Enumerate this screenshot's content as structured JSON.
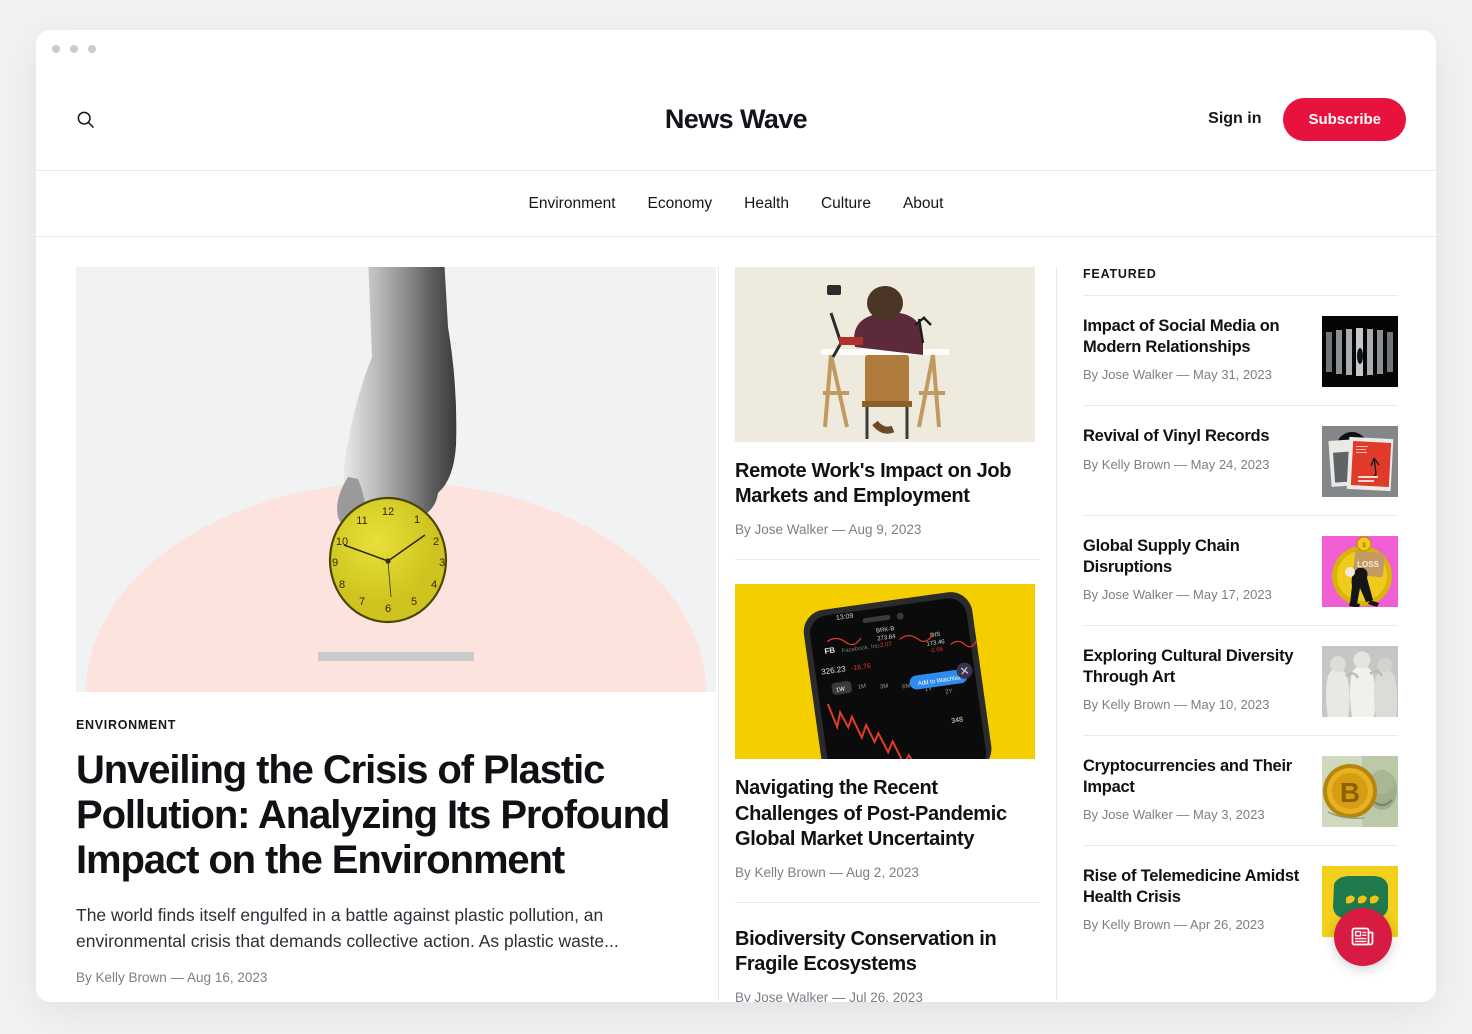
{
  "window": {
    "dots": 3
  },
  "masthead": {
    "brand": "News Wave",
    "search_icon": "search-icon",
    "signin_label": "Sign in",
    "subscribe_label": "Subscribe",
    "accent_color": "#e8123e"
  },
  "nav": {
    "items": [
      {
        "label": "Environment"
      },
      {
        "label": "Economy"
      },
      {
        "label": "Health"
      },
      {
        "label": "Culture"
      },
      {
        "label": "About"
      }
    ]
  },
  "hero": {
    "image_alt": "hand-holding-yellow-clock-illustration",
    "kicker": "ENVIRONMENT",
    "title": "Unveiling the Crisis of Plastic Pollution: Analyzing Its Profound Impact on the Environment",
    "excerpt": "The world finds itself engulfed in a battle against plastic pollution, an environmental crisis that demands collective action. As plastic waste...",
    "byline": "By Kelly Brown — Aug 16, 2023"
  },
  "mid_column": {
    "cards": [
      {
        "image_alt": "person-at-desk-working-photo",
        "title": "Remote Work's Impact on Job Markets and Employment",
        "byline": "By Jose Walker — Aug 9, 2023",
        "has_image": true
      },
      {
        "image_alt": "smartphone-stock-chart-on-yellow-photo",
        "title": "Navigating the Recent Challenges of Post-Pandemic Global Market Uncertainty",
        "byline": "By Kelly Brown — Aug 2, 2023",
        "has_image": true
      },
      {
        "image_alt": "",
        "title": "Biodiversity Conservation in Fragile Ecosystems",
        "byline": "By Jose Walker — Jul 26, 2023",
        "has_image": false
      }
    ]
  },
  "sidebar": {
    "section_label": "FEATURED",
    "items": [
      {
        "title": "Impact of Social Media on Modern Relationships",
        "byline": "By Jose Walker — May 31, 2023",
        "thumb_alt": "dark-vertical-blinds-silhouette-photo"
      },
      {
        "title": "Revival of Vinyl Records",
        "byline": "By Kelly Brown — May 24, 2023",
        "thumb_alt": "vinyl-record-sleeve-red-photo"
      },
      {
        "title": "Global Supply Chain Disruptions",
        "byline": "By Jose Walker — May 17, 2023",
        "thumb_alt": "person-carrying-loss-box-on-coin-illustration"
      },
      {
        "title": "Exploring Cultural Diversity Through Art",
        "byline": "By Kelly Brown — May 10, 2023",
        "thumb_alt": "classical-marble-statues-photo"
      },
      {
        "title": "Cryptocurrencies and Their Impact",
        "byline": "By Jose Walker — May 3, 2023",
        "thumb_alt": "bitcoin-coin-on-dollar-bill-photo"
      },
      {
        "title": "Rise of Telemedicine Amidst Health Crisis",
        "byline": "By Kelly Brown — Apr 26, 2023",
        "thumb_alt": "green-speech-bubble-on-yellow-illustration"
      }
    ]
  },
  "fab": {
    "icon": "newspaper-icon",
    "color": "#d81b42"
  }
}
